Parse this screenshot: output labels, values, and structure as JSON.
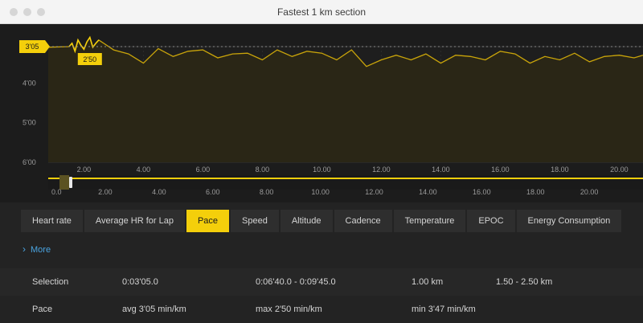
{
  "window": {
    "title": "Fastest 1 km section"
  },
  "colors": {
    "accent": "#f4cf0b",
    "line": "#c9a40a",
    "link": "#4aa3df"
  },
  "chart_data": {
    "type": "line",
    "title": "",
    "ylabel": "min/km",
    "y_ticks": [
      "3'05",
      "4'00",
      "5'00",
      "6'00"
    ],
    "y_tick_values": [
      3.083,
      4.0,
      5.0,
      6.0
    ],
    "ylim_seconds_per_km": [
      185,
      360
    ],
    "x_ticks": [
      "2.00",
      "4.00",
      "6.00",
      "8.00",
      "10.00",
      "12.00",
      "14.00",
      "16.00",
      "18.00",
      "20.00"
    ],
    "xlim_km": [
      0.8,
      20.8
    ],
    "selection_km": [
      1.5,
      2.5
    ],
    "selection_label": "2'50",
    "avg_pace_label": "3'05",
    "series": [
      {
        "x": [
          0.8,
          1.5,
          1.6,
          1.7,
          1.8,
          1.9,
          2.0,
          2.1,
          2.2,
          2.3,
          2.4,
          2.5,
          3.0,
          3.5,
          4.0,
          4.5,
          5.0,
          5.5,
          6.0,
          6.5,
          7.0,
          7.5,
          8.0,
          8.5,
          9.0,
          9.5,
          10.0,
          10.5,
          11.0,
          11.5,
          12.0,
          12.5,
          13.0,
          13.5,
          14.0,
          14.5,
          15.0,
          15.5,
          16.0,
          16.5,
          17.0,
          17.5,
          18.0,
          18.5,
          19.0,
          19.5,
          20.0,
          20.5,
          20.8
        ],
        "y": [
          186,
          185,
          180,
          192,
          175,
          183,
          189,
          178,
          171,
          186,
          180,
          175,
          190,
          196,
          210,
          188,
          200,
          192,
          190,
          202,
          196,
          195,
          205,
          190,
          200,
          192,
          195,
          205,
          190,
          215,
          205,
          198,
          205,
          196,
          210,
          198,
          200,
          205,
          192,
          196,
          210,
          200,
          205,
          195,
          208,
          200,
          198,
          202,
          198
        ]
      }
    ],
    "bottom_x_ticks": [
      "0.0",
      "2.00",
      "4.00",
      "6.00",
      "8.00",
      "10.00",
      "12.00",
      "14.00",
      "16.00",
      "18.00",
      "20.00"
    ],
    "handle_label": "0"
  },
  "tabs": [
    "Heart rate",
    "Average HR for Lap",
    "Pace",
    "Speed",
    "Altitude",
    "Cadence",
    "Temperature",
    "EPOC",
    "Energy Consumption"
  ],
  "active_tab": "Pace",
  "more": {
    "label": "More"
  },
  "rows": [
    {
      "label": "Selection",
      "c1": "0:03'05.0",
      "c2": "0:06'40.0 - 0:09'45.0",
      "c3": "1.00 km",
      "c4": "1.50 - 2.50 km"
    },
    {
      "label": "Pace",
      "c1": "avg 3'05 min/km",
      "c2": "max 2'50 min/km",
      "c3": "min 3'47 min/km",
      "c4": ""
    }
  ]
}
